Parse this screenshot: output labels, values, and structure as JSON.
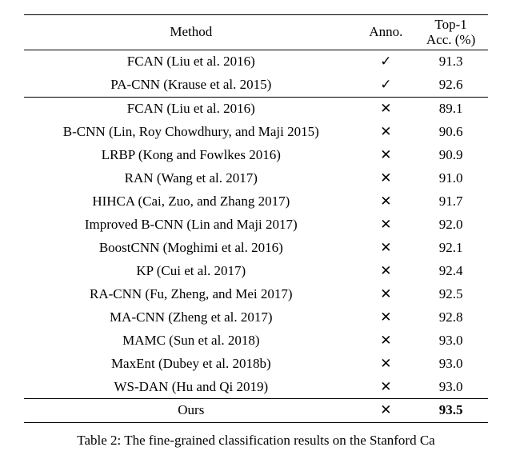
{
  "chart_data": {
    "type": "table",
    "title": "",
    "columns": [
      "Method",
      "Anno.",
      "Top-1 Acc. (%)"
    ],
    "groups": [
      {
        "rows": [
          {
            "method": "FCAN (Liu et al. 2016)",
            "anno": "✓",
            "acc": "91.3"
          },
          {
            "method": "PA-CNN (Krause et al. 2015)",
            "anno": "✓",
            "acc": "92.6"
          }
        ]
      },
      {
        "rows": [
          {
            "method": "FCAN (Liu et al. 2016)",
            "anno": "✕",
            "acc": "89.1"
          },
          {
            "method": "B-CNN (Lin, Roy Chowdhury, and Maji 2015)",
            "anno": "✕",
            "acc": "90.6"
          },
          {
            "method": "LRBP (Kong and Fowlkes 2016)",
            "anno": "✕",
            "acc": "90.9"
          },
          {
            "method": "RAN (Wang et al. 2017)",
            "anno": "✕",
            "acc": "91.0"
          },
          {
            "method": "HIHCA (Cai, Zuo, and Zhang 2017)",
            "anno": "✕",
            "acc": "91.7"
          },
          {
            "method": "Improved B-CNN (Lin and Maji 2017)",
            "anno": "✕",
            "acc": "92.0"
          },
          {
            "method": "BoostCNN (Moghimi et al. 2016)",
            "anno": "✕",
            "acc": "92.1"
          },
          {
            "method": "KP (Cui et al. 2017)",
            "anno": "✕",
            "acc": "92.4"
          },
          {
            "method": "RA-CNN (Fu, Zheng, and Mei 2017)",
            "anno": "✕",
            "acc": "92.5"
          },
          {
            "method": "MA-CNN (Zheng et al. 2017)",
            "anno": "✕",
            "acc": "92.8"
          },
          {
            "method": "MAMC (Sun et al. 2018)",
            "anno": "✕",
            "acc": "93.0"
          },
          {
            "method": "MaxEnt (Dubey et al. 2018b)",
            "anno": "✕",
            "acc": "93.0"
          },
          {
            "method": "WS-DAN (Hu and Qi 2019)",
            "anno": "✕",
            "acc": "93.0"
          }
        ]
      },
      {
        "rows": [
          {
            "method": "Ours",
            "anno": "✕",
            "acc": "93.5",
            "bold_acc": true
          }
        ]
      }
    ]
  },
  "header": {
    "method": "Method",
    "anno": "Anno.",
    "acc_line1": "Top-1",
    "acc_line2": "Acc. (%)"
  },
  "caption_prefix": "Table 2: The fine-grained classification results on the Stanford Ca"
}
